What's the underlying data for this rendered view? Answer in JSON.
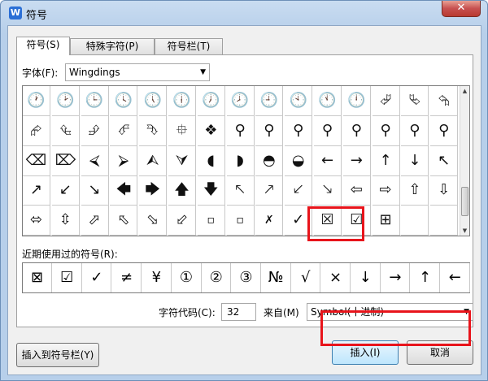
{
  "window": {
    "title": "符号",
    "app_icon": "W",
    "close_label": "✕"
  },
  "tabs": [
    {
      "label": "符号(S)",
      "active": true
    },
    {
      "label": "特殊字符(P)",
      "active": false
    },
    {
      "label": "符号栏(T)",
      "active": false
    }
  ],
  "font": {
    "label": "字体(F):",
    "value": "Wingdings",
    "arrow": "▼"
  },
  "symbol_grid": {
    "rows": [
      [
        "🕐",
        "🕑",
        "🕒",
        "🕓",
        "🕔",
        "🕕",
        "🕖",
        "🕗",
        "🕘",
        "🕙",
        "🕚",
        "🕛",
        "⮰",
        "⮱",
        "⮲"
      ],
      [
        "⮳",
        "⮴",
        "⮵",
        "⮶",
        "⮷",
        "⯐",
        "❖",
        "⚲",
        "⚲",
        "⚲",
        "⚲",
        "⚲",
        "⚲",
        "⚲",
        "⚲"
      ],
      [
        "⌫",
        "⌦",
        "⮘",
        "⮚",
        "⮙",
        "⮛",
        "◖",
        "◗",
        "◓",
        "◒",
        "←",
        "→",
        "↑",
        "↓",
        "↖"
      ],
      [
        "↗",
        "↙",
        "↘",
        "🡄",
        "🡆",
        "🡅",
        "🡇",
        "🡔",
        "🡕",
        "🡗",
        "🡖",
        "⇦",
        "⇨",
        "⇧",
        "⇩"
      ],
      [
        "⬄",
        "⇳",
        "⬀",
        "⬁",
        "⬂",
        "⬃",
        "▫",
        "▫",
        "✗",
        "✓",
        "☒",
        "☑",
        "⊞",
        "",
        ""
      ]
    ]
  },
  "scroll": {
    "up": "▲",
    "down": "▼"
  },
  "recent": {
    "label": "近期使用过的符号(R):",
    "items": [
      "⊠",
      "☑",
      "✓",
      "≠",
      "¥",
      "①",
      "②",
      "③",
      "№",
      "√",
      "×",
      "↓",
      "→",
      "↑",
      "←"
    ]
  },
  "char_code": {
    "label": "字符代码(C):",
    "value": "32"
  },
  "from": {
    "label": "来自(M)",
    "value": "Symbol(十进制)",
    "arrow": "▼"
  },
  "buttons": {
    "add_to_bar": "插入到符号栏(Y)",
    "insert": "插入(I)",
    "cancel": "取消"
  }
}
